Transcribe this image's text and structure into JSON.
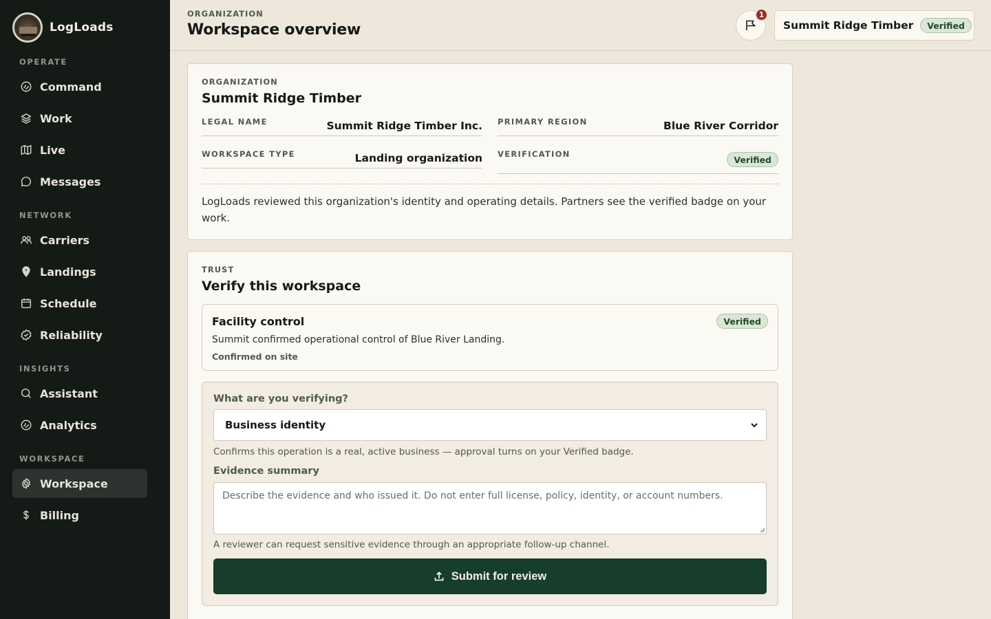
{
  "app": {
    "name": "LogLoads"
  },
  "sidebar": {
    "sections": [
      {
        "label": "OPERATE"
      },
      {
        "label": "NETWORK"
      },
      {
        "label": "INSIGHTS"
      },
      {
        "label": "WORKSPACE"
      }
    ],
    "items": [
      {
        "label": "Command",
        "icon": "command-icon"
      },
      {
        "label": "Work",
        "icon": "layers-icon"
      },
      {
        "label": "Live",
        "icon": "map-icon"
      },
      {
        "label": "Messages",
        "icon": "chat-icon"
      },
      {
        "label": "Carriers",
        "icon": "users-icon"
      },
      {
        "label": "Landings",
        "icon": "pin-icon"
      },
      {
        "label": "Schedule",
        "icon": "calendar-icon"
      },
      {
        "label": "Reliability",
        "icon": "badge-check-icon"
      },
      {
        "label": "Assistant",
        "icon": "search-icon"
      },
      {
        "label": "Analytics",
        "icon": "analytics-icon"
      },
      {
        "label": "Workspace",
        "icon": "gear-icon",
        "active": true
      },
      {
        "label": "Billing",
        "icon": "dollar-icon"
      }
    ]
  },
  "header": {
    "eyebrow": "ORGANIZATION",
    "title": "Workspace overview",
    "notifications_count": "1",
    "org_name": "Summit Ridge Timber",
    "org_badge": "Verified"
  },
  "organization_card": {
    "eyebrow": "ORGANIZATION",
    "title": "Summit Ridge Timber",
    "fields": [
      {
        "label": "LEGAL NAME",
        "value": "Summit Ridge Timber Inc."
      },
      {
        "label": "PRIMARY REGION",
        "value": "Blue River Corridor"
      },
      {
        "label": "WORKSPACE TYPE",
        "value": "Landing organization"
      },
      {
        "label": "VERIFICATION",
        "value": "Verified"
      }
    ],
    "description": "LogLoads reviewed this organization's identity and operating details. Partners see the verified badge on your work."
  },
  "trust_card": {
    "eyebrow": "TRUST",
    "title": "Verify this workspace",
    "facility": {
      "title": "Facility control",
      "badge": "Verified",
      "description": "Summit confirmed operational control of Blue River Landing.",
      "note": "Confirmed on site"
    },
    "form": {
      "select_label": "What are you verifying?",
      "select_value": "Business identity",
      "select_help": "Confirms this operation is a real, active business — approval turns on your Verified badge.",
      "evidence_label": "Evidence summary",
      "evidence_placeholder": "Describe the evidence and who issued it. Do not enter full license, policy, identity, or account numbers.",
      "evidence_help": "A reviewer can request sensitive evidence through an appropriate follow-up channel.",
      "submit_label": "Submit for review"
    }
  },
  "colors": {
    "sidebar_bg": "#141a16",
    "page_bg": "#ede7dc",
    "accent": "#173d2c",
    "badge_bg": "#dbe7d6",
    "notification": "#9b2b23"
  }
}
